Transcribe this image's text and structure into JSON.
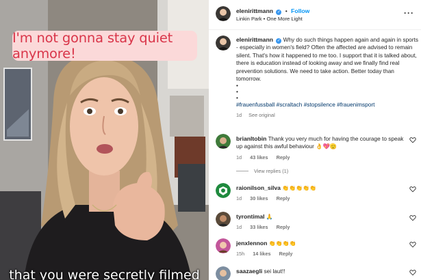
{
  "video": {
    "quote": "I'm not gonna stay quiet anymore!",
    "subtitle": "that you were secretly filmed"
  },
  "post": {
    "author": "elenirittmann",
    "follow_label": "Follow",
    "separator": "•",
    "audio": "Linkin Park • One More Light",
    "more_icon": "more-horizontal-icon",
    "caption": {
      "author": "elenirittmann",
      "text": "Why do such things happen again and again in sports - especially in women's field? Often the affected are advised to remain silent. That's how it happened to me too. I support that it is talked about, there is education instead of looking away and we finally find real prevention solutions. We need to take action. Better today than tomorrow.",
      "bullets": [
        "•",
        "•",
        "•"
      ],
      "hashtags": "#frauenfussball #scraltach #stopsilence #frauenimsport",
      "age": "1d",
      "see_original": "See original"
    }
  },
  "comments": [
    {
      "user": "brianltobin",
      "text": "Thank you very much for having the courage to speak up against this awful behaviour 👌💖🫡",
      "age": "1d",
      "likes": "43 likes",
      "reply": "Reply",
      "view_replies": "View replies (1)"
    },
    {
      "user": "raionilson_silva",
      "text": "👏👏👏👏👏",
      "age": "1d",
      "likes": "30 likes",
      "reply": "Reply"
    },
    {
      "user": "tyrontimal",
      "text": "🙏",
      "age": "1d",
      "likes": "33 likes",
      "reply": "Reply"
    },
    {
      "user": "jenxlennon",
      "text": "👏👏👏👏",
      "age": "15h",
      "likes": "14 likes",
      "reply": "Reply"
    },
    {
      "user": "saazaegli",
      "text": "sei laut!!",
      "age": "",
      "likes": "",
      "reply": ""
    }
  ],
  "colors": {
    "link_blue": "#0095f6",
    "hashtag_blue": "#00376b",
    "quote_red": "#d9364a",
    "quote_bg": "#fbd9d9",
    "verified_blue": "#3897f0",
    "meta_gray": "#737373"
  },
  "icons": [
    "verified-badge-icon",
    "heart-icon",
    "more-horizontal-icon"
  ]
}
